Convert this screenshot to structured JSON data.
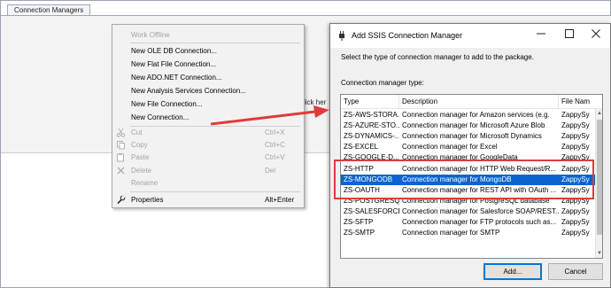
{
  "designer": {
    "tab_label": "Connection Managers",
    "hint_partial": "click her"
  },
  "context_menu": {
    "items": [
      {
        "label": "Work Offline",
        "enabled": false
      },
      {
        "label": "New OLE DB Connection...",
        "enabled": true
      },
      {
        "label": "New Flat File Connection...",
        "enabled": true
      },
      {
        "label": "New ADO.NET Connection...",
        "enabled": true
      },
      {
        "label": "New Analysis Services Connection...",
        "enabled": true
      },
      {
        "label": "New File Connection...",
        "enabled": true
      },
      {
        "label": "New Connection...",
        "enabled": true
      },
      {
        "label": "Cut",
        "shortcut": "Ctrl+X",
        "icon": "cut-icon",
        "enabled": false
      },
      {
        "label": "Copy",
        "shortcut": "Ctrl+C",
        "icon": "copy-icon",
        "enabled": false
      },
      {
        "label": "Paste",
        "shortcut": "Ctrl+V",
        "icon": "paste-icon",
        "enabled": false
      },
      {
        "label": "Delete",
        "shortcut": "Del",
        "icon": "delete-icon",
        "enabled": false
      },
      {
        "label": "Rename",
        "enabled": false
      },
      {
        "label": "Properties",
        "shortcut": "Alt+Enter",
        "icon": "wrench-icon",
        "enabled": true
      }
    ]
  },
  "dialog": {
    "title": "Add SSIS Connection Manager",
    "description": "Select the type of connection manager to add to the package.",
    "list_label": "Connection manager type:",
    "columns": [
      "Type",
      "Description",
      "File Nam"
    ],
    "rows": [
      {
        "type": "ZS-AWS-STORA...",
        "description": "Connection manager for Amazon services (e.g.",
        "file": "ZappySy"
      },
      {
        "type": "ZS-AZURE-STO...",
        "description": "Connection manager for Microsoft Azure Blob",
        "file": "ZappySy"
      },
      {
        "type": "ZS-DYNAMICS-...",
        "description": "Connection manager for Microsoft Dynamics",
        "file": "ZappySy"
      },
      {
        "type": "ZS-EXCEL",
        "description": "Connection manager for Excel",
        "file": "ZappySy"
      },
      {
        "type": "ZS-GOOGLE-D...",
        "description": "Connection manager for GoogleData",
        "file": "ZappySy"
      },
      {
        "type": "ZS-HTTP",
        "description": "Connection manager for HTTP Web Request/R...",
        "file": "ZappySy"
      },
      {
        "type": "ZS-MONGODB",
        "description": "Connection manager for MongoDB",
        "file": "ZappySy"
      },
      {
        "type": "ZS-OAUTH",
        "description": "Connection manager for REST API with OAuth ...",
        "file": "ZappySy"
      },
      {
        "type": "ZS-POSTGRESQL",
        "description": "Connection manager for PostgreSQL database",
        "file": "ZappySy"
      },
      {
        "type": "ZS-SALESFORCE",
        "description": "Connection manager for Salesforce SOAP/REST...",
        "file": "ZappySy"
      },
      {
        "type": "ZS-SFTP",
        "description": "Connection manager for FTP protocols such as...",
        "file": "ZappySy"
      },
      {
        "type": "ZS-SMTP",
        "description": "Connection manager for SMTP",
        "file": "ZappySy"
      }
    ],
    "selected_index": 6,
    "add_label": "Add...",
    "cancel_label": "Cancel"
  },
  "colors": {
    "selection": "#0a64d2",
    "annotation": "#e03b3b"
  }
}
